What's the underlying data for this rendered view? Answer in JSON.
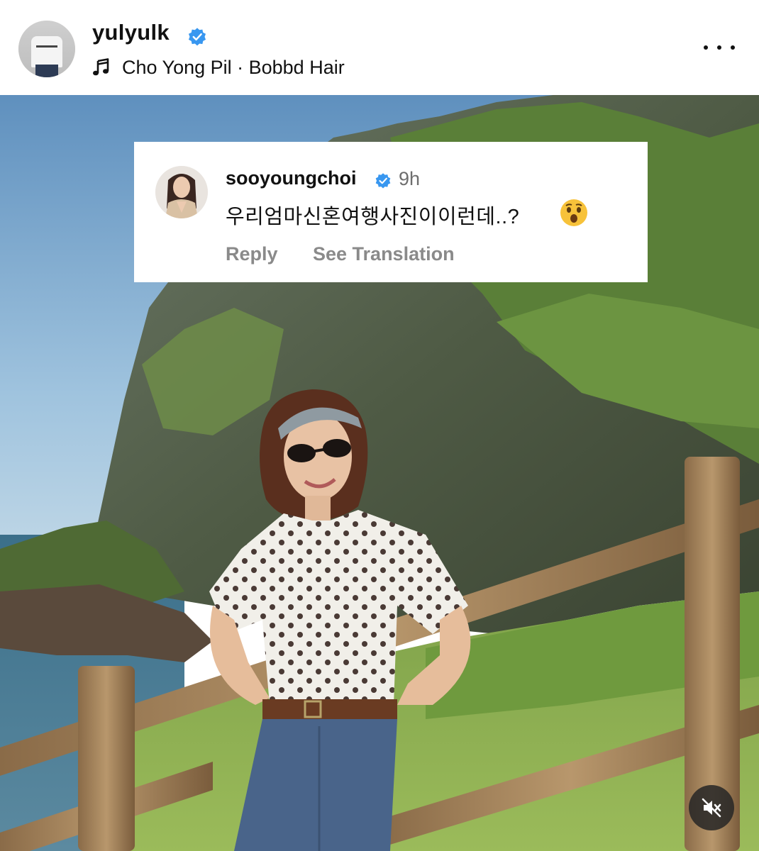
{
  "post": {
    "username": "yulyulk",
    "music": "Cho Yong Pil · Bobbd Hair",
    "more_icon": "more-horizontal-icon"
  },
  "comment": {
    "username": "sooyoungchoi",
    "time": "9h",
    "text": "우리엄마신혼여행사진이이런데..?",
    "emoji": "astonished-face-emoji",
    "reply_label": "Reply",
    "translate_label": "See Translation"
  },
  "colors": {
    "verified": "#3897f0",
    "secondary_text": "#8a8a8a"
  },
  "controls": {
    "mute_icon": "muted-speaker-icon"
  }
}
